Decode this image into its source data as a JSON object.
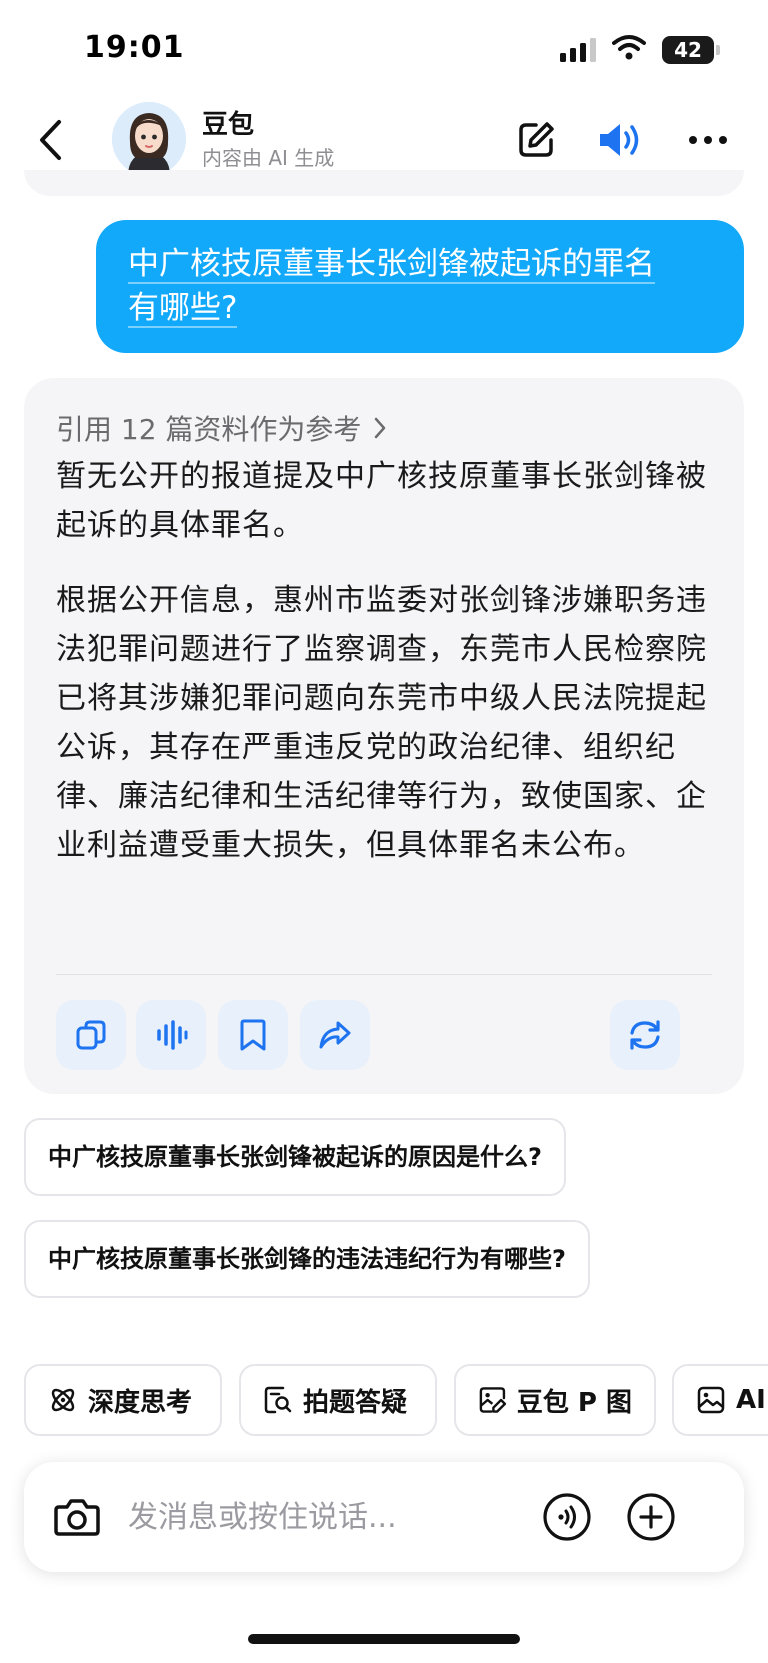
{
  "status_bar": {
    "time": "19:01",
    "battery": "42"
  },
  "header": {
    "title": "豆包",
    "subtitle": "内容由 AI 生成"
  },
  "user_message": {
    "line1": "中广核技原董事长张剑锋被起诉的罪名",
    "line2": "有哪些?"
  },
  "answer": {
    "reference_label": "引用 12 篇资料作为参考",
    "paragraphs": [
      "暂无公开的报道提及中广核技原董事长张剑锋被起诉的具体罪名。",
      "根据公开信息，惠州市监委对张剑锋涉嫌职务违法犯罪问题进行了监察调查，东莞市人民检察院已将其涉嫌犯罪问题向东莞市中级人民法院提起公诉，其存在严重违反党的政治纪律、组织纪律、廉洁纪律和生活纪律等行为，致使国家、企业利益遭受重大损失，但具体罪名未公布。"
    ]
  },
  "suggestions": [
    "中广核技原董事长张剑锋被起诉的原因是什么?",
    "中广核技原董事长张剑锋的违法违纪行为有哪些?"
  ],
  "quick_actions": [
    {
      "label": "深度思考",
      "icon": "atom-icon"
    },
    {
      "label": "拍题答疑",
      "icon": "photo-search-icon"
    },
    {
      "label": "豆包 P 图",
      "icon": "image-edit-icon"
    },
    {
      "label": "AI",
      "icon": "image-icon"
    }
  ],
  "input": {
    "placeholder": "发消息或按住说话..."
  },
  "colors": {
    "accent": "#12a9fb",
    "action_blue": "#1d73f0",
    "card_bg": "#f5f5f7"
  }
}
